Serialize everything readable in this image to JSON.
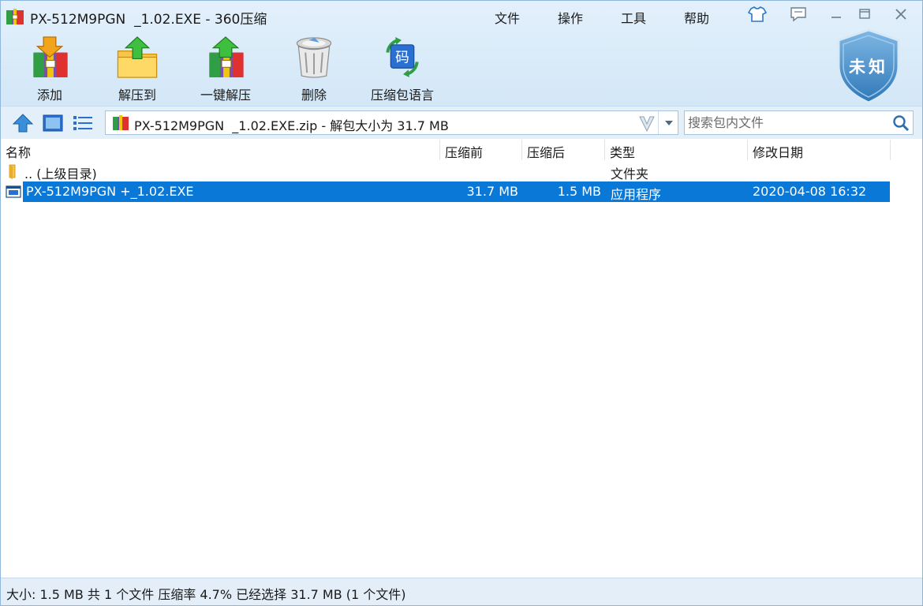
{
  "window": {
    "title": "PX-512M9PGN  _1.02.EXE - 360压缩"
  },
  "menu": {
    "file": "文件",
    "operate": "操作",
    "tools": "工具",
    "help": "帮助"
  },
  "toolbar": {
    "add": "添加",
    "extract_to": "解压到",
    "one_click_extract": "一键解压",
    "delete": "删除",
    "archive_language": "压缩包语言"
  },
  "security_badge": "未知",
  "address": {
    "path": "PX-512M9PGN  _1.02.EXE.zip - 解包大小为 31.7 MB"
  },
  "search": {
    "placeholder": "搜索包内文件"
  },
  "columns": {
    "name": "名称",
    "original": "压缩前",
    "compressed": "压缩后",
    "type": "类型",
    "modified": "修改日期"
  },
  "rows": [
    {
      "name": ".. (上级目录)",
      "original": "",
      "compressed": "",
      "type": "文件夹",
      "modified": ""
    },
    {
      "name": "PX-512M9PGN +_1.02.EXE",
      "original": "31.7 MB",
      "compressed": "1.5 MB",
      "type": "应用程序",
      "modified": "2020-04-08 16:32"
    }
  ],
  "status": {
    "text": "大小: 1.5 MB 共 1 个文件 压缩率 4.7% 已经选择 31.7 MB (1 个文件)"
  },
  "colors": {
    "selection": "#0a78d7",
    "chrome_bg": "#d9ebf9",
    "shield": "#3a86c4"
  }
}
